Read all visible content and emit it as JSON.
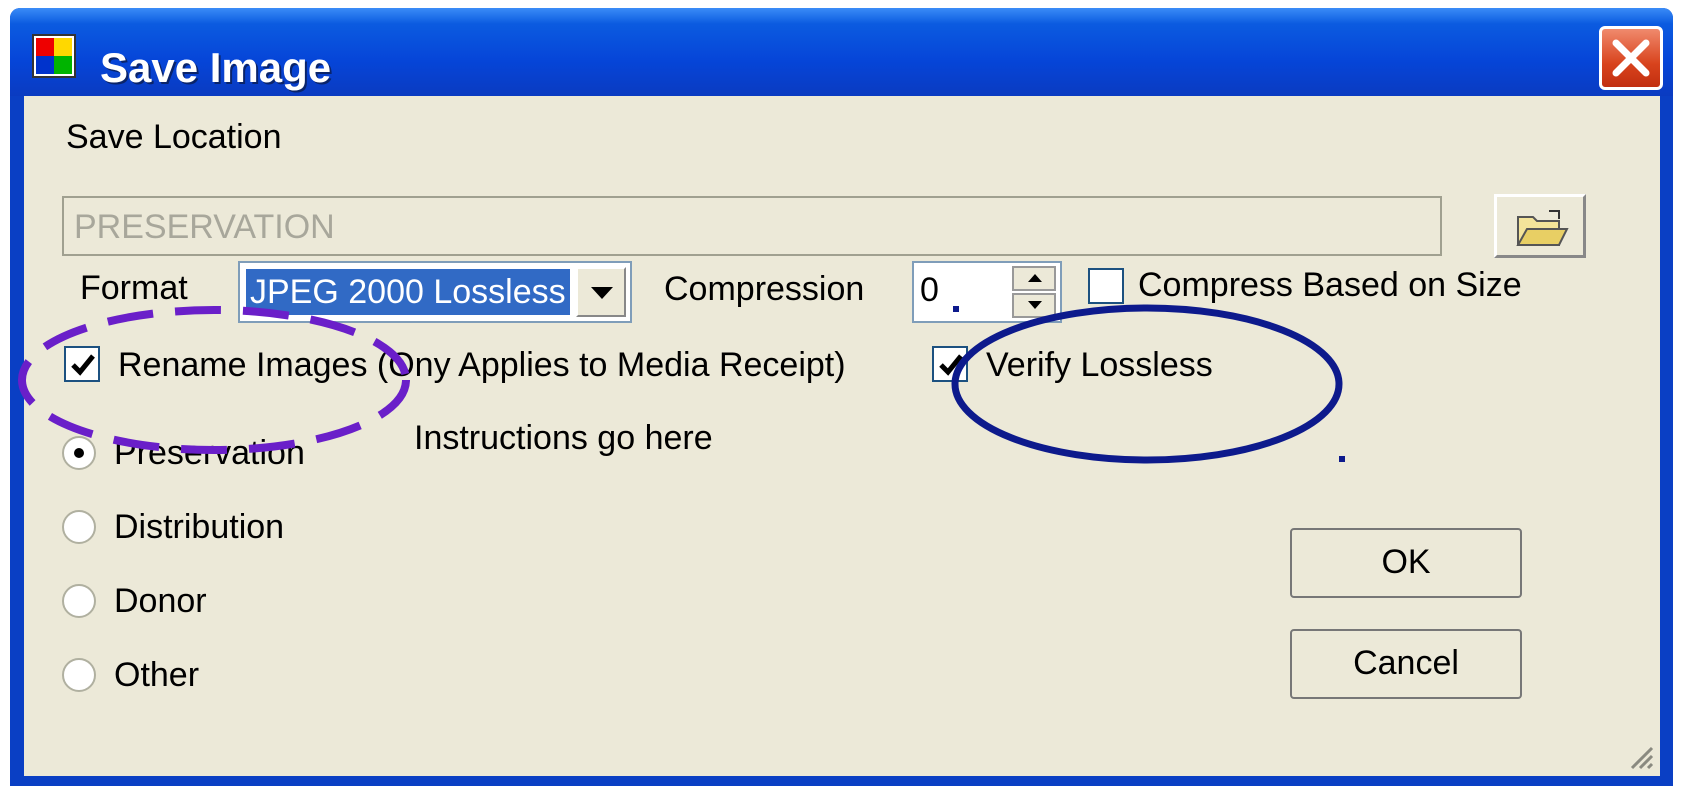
{
  "window": {
    "title": "Save Image"
  },
  "save_location": {
    "label": "Save Location",
    "value": "PRESERVATION"
  },
  "format": {
    "label": "Format",
    "selected": "JPEG 2000 Lossless"
  },
  "compression": {
    "label": "Compression",
    "value": "0"
  },
  "compress_based_on_size": {
    "label": "Compress Based on Size",
    "checked": false
  },
  "rename_images": {
    "label": "Rename Images (Ony Applies to Media Receipt)",
    "checked": true
  },
  "verify_lossless": {
    "label": "Verify Lossless",
    "checked": true
  },
  "instructions": "Instructions go here",
  "radios": [
    {
      "label": "Preservation",
      "selected": true
    },
    {
      "label": "Distribution",
      "selected": false
    },
    {
      "label": "Donor",
      "selected": false
    },
    {
      "label": "Other",
      "selected": false
    }
  ],
  "buttons": {
    "ok": "OK",
    "cancel": "Cancel"
  },
  "annotation_colors": {
    "purple_dashed": "#6a1fc9",
    "navy_solid": "#0d1a8c"
  },
  "icons": [
    "app-icon",
    "close-icon",
    "folder-open-icon",
    "checkmark-icon",
    "resize-grip-icon"
  ]
}
